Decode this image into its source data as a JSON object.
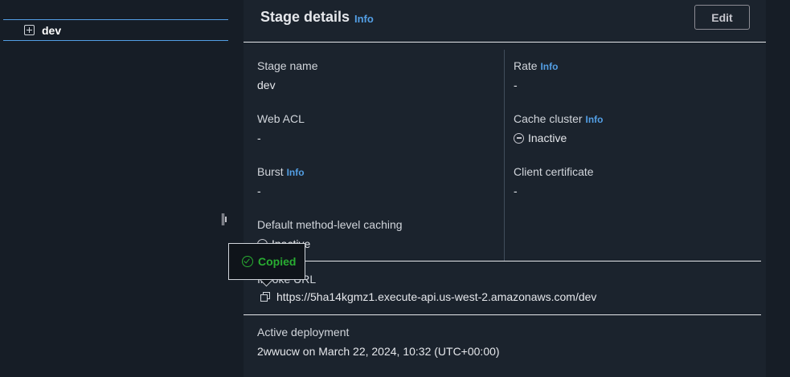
{
  "tree": {
    "stage_label": "dev"
  },
  "header": {
    "title": "Stage details",
    "info": "Info",
    "edit_label": "Edit"
  },
  "left_column": {
    "stage_name": {
      "label": "Stage name",
      "value": "dev"
    },
    "web_acl": {
      "label": "Web ACL",
      "value": "-"
    },
    "burst": {
      "label": "Burst",
      "info": "Info",
      "value": "-"
    },
    "default_caching": {
      "label": "Default method-level caching",
      "value": "Inactive"
    }
  },
  "right_column": {
    "rate": {
      "label": "Rate",
      "info": "Info",
      "value": "-"
    },
    "cache_cluster": {
      "label": "Cache cluster",
      "info": "Info",
      "value": "Inactive"
    },
    "client_certificate": {
      "label": "Client certificate",
      "value": "-"
    }
  },
  "invoke_url": {
    "label": "Invoke URL",
    "value": "https://5ha14kgmz1.execute-api.us-west-2.amazonaws.com/dev"
  },
  "active_deployment": {
    "label": "Active deployment",
    "value": "2wwucw on March 22, 2024, 10:32 (UTC+00:00)"
  },
  "popover": {
    "text": "Copied"
  },
  "colors": {
    "accent": "#539fe5",
    "success": "#29ad32",
    "background": "#1b232d"
  }
}
